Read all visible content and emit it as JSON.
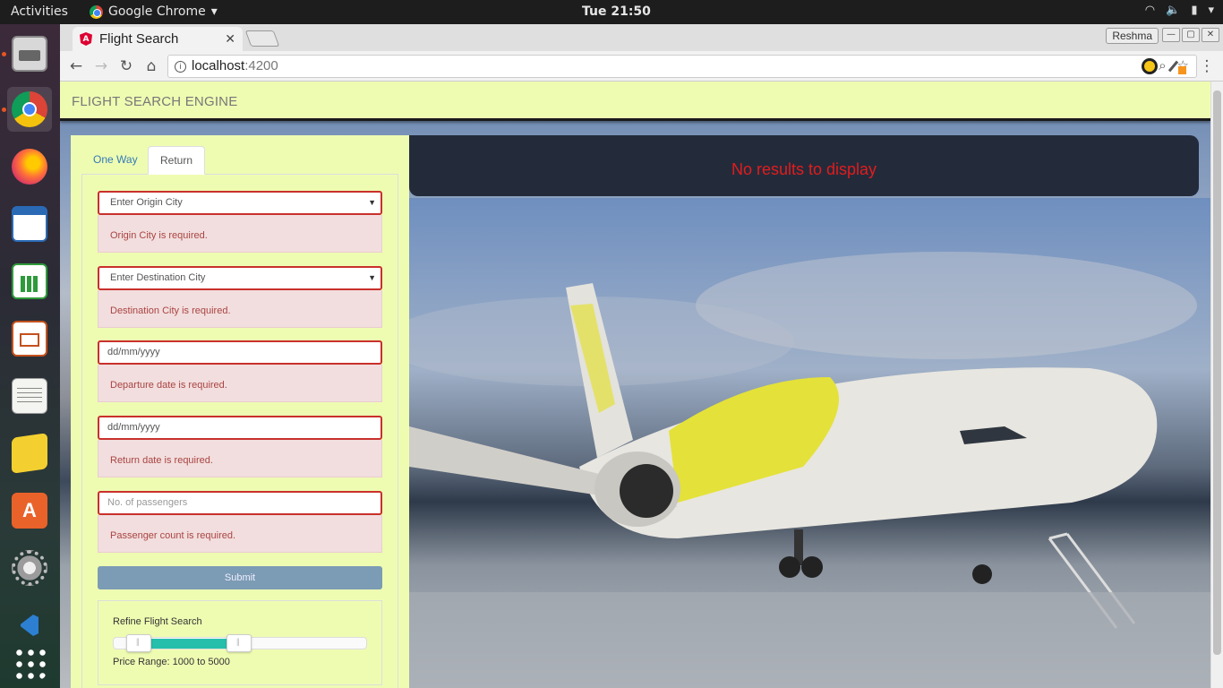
{
  "system": {
    "activities_label": "Activities",
    "app_menu_label": "Google Chrome",
    "clock": "Tue 21:50"
  },
  "dock": {
    "items": [
      "files",
      "chrome",
      "firefox",
      "writer",
      "calc",
      "impress",
      "text-editor",
      "notes",
      "software-center",
      "settings",
      "vscode",
      "show-apps"
    ]
  },
  "browser": {
    "tab_title": "Flight Search",
    "profile_name": "Reshma",
    "url_host": "localhost",
    "url_port": ":4200"
  },
  "app": {
    "brand": "FLIGHT SEARCH ENGINE",
    "tabs": [
      {
        "label": "One Way",
        "active": false
      },
      {
        "label": "Return",
        "active": true
      }
    ],
    "fields": {
      "origin": {
        "value": "Enter Origin City",
        "error": "Origin City is required."
      },
      "destination": {
        "value": "Enter Destination City",
        "error": "Destination City is required."
      },
      "departure": {
        "placeholder": "dd/mm/yyyy",
        "error": "Departure date is required."
      },
      "return": {
        "placeholder": "dd/mm/yyyy",
        "error": "Return date is required."
      },
      "passengers": {
        "placeholder": "No. of passengers",
        "error": "Passenger count is required."
      }
    },
    "submit_label": "Submit",
    "refine": {
      "title": "Refine Flight Search",
      "price_range_text": "Price Range: 1000 to 5000",
      "slider_min_value": 1000,
      "slider_max_value": 5000
    },
    "results_message": "No results to display"
  },
  "colors": {
    "panel_bg": "#eefcb2",
    "error_border": "#c9302c",
    "alert_bg": "#f2dede",
    "alert_text": "#a94442",
    "results_bg": "#232b3b",
    "results_text": "#e31c1c",
    "slider_fill": "#26bfac",
    "submit_bg": "#7c9bb4"
  }
}
